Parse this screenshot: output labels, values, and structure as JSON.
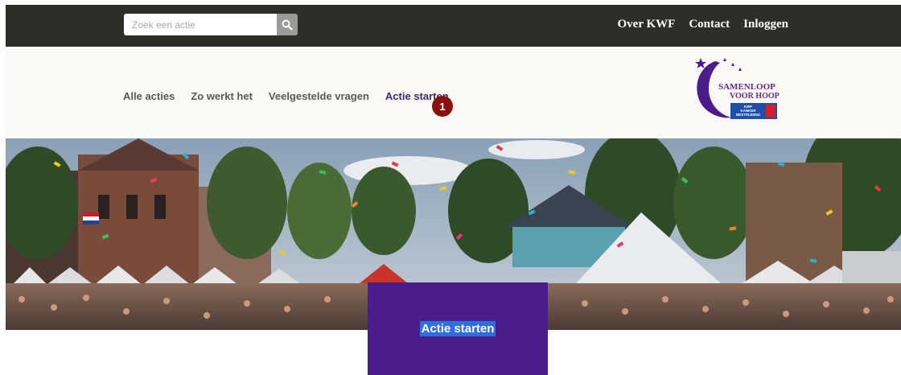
{
  "search": {
    "placeholder": "Zoek een actie",
    "icon": "search-icon"
  },
  "top_links": [
    {
      "label": "Over KWF"
    },
    {
      "label": "Contact"
    },
    {
      "label": "Inloggen"
    }
  ],
  "nav": {
    "items": [
      {
        "label": "Alle acties"
      },
      {
        "label": "Zo werkt het"
      },
      {
        "label": "Veelgestelde vragen"
      },
      {
        "label": "Actie starten"
      }
    ],
    "badge": "1"
  },
  "logo": {
    "line1": "SAMENLOOP",
    "line2": "VOOR HOOP",
    "sub1": "KWF",
    "sub2": "KANKER",
    "sub3": "BESTRIJDING"
  },
  "hero": {
    "image": "festival-crowd-confetti-photo"
  },
  "cta": {
    "label": "Actie starten"
  },
  "colors": {
    "topbar": "#2e2e28",
    "nav_text": "#5a5a4e",
    "brand_purple": "#4b1d8a",
    "badge": "#8a1010",
    "selection_blue": "#2f6fdb"
  }
}
